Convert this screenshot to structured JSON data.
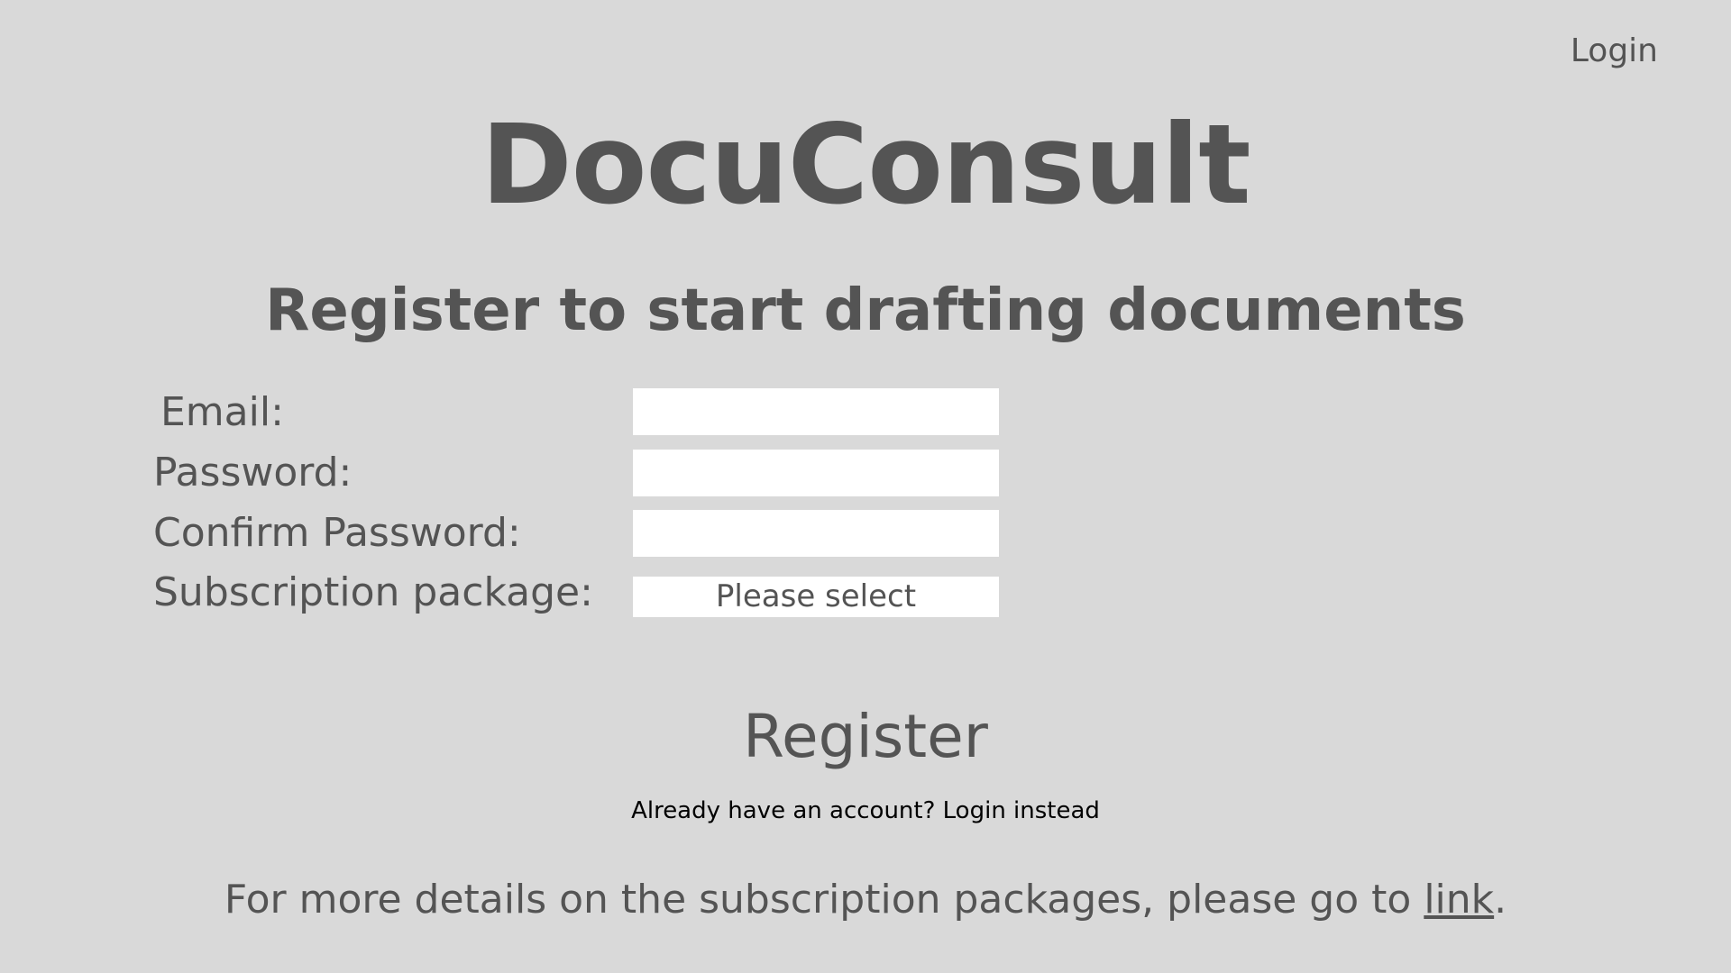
{
  "header": {
    "login_label": "Login"
  },
  "app_title": "DocuConsult",
  "subtitle": "Register to start drafting documents",
  "form": {
    "email_label": "Email:",
    "email_value": "",
    "password_label": "Password:",
    "password_value": "",
    "confirm_password_label": "Confirm Password:",
    "confirm_password_value": "",
    "subscription_label": "Subscription package:",
    "subscription_selected": "Please select"
  },
  "register_label": "Register",
  "login_instead_label": "Already have an account? Login instead",
  "footer": {
    "text_before": "For more details on the subscription packages, please go to ",
    "link_label": "link",
    "text_after": "."
  },
  "colors": {
    "background": "#d9d9d9",
    "text": "#545454",
    "input_background": "#ffffff"
  }
}
